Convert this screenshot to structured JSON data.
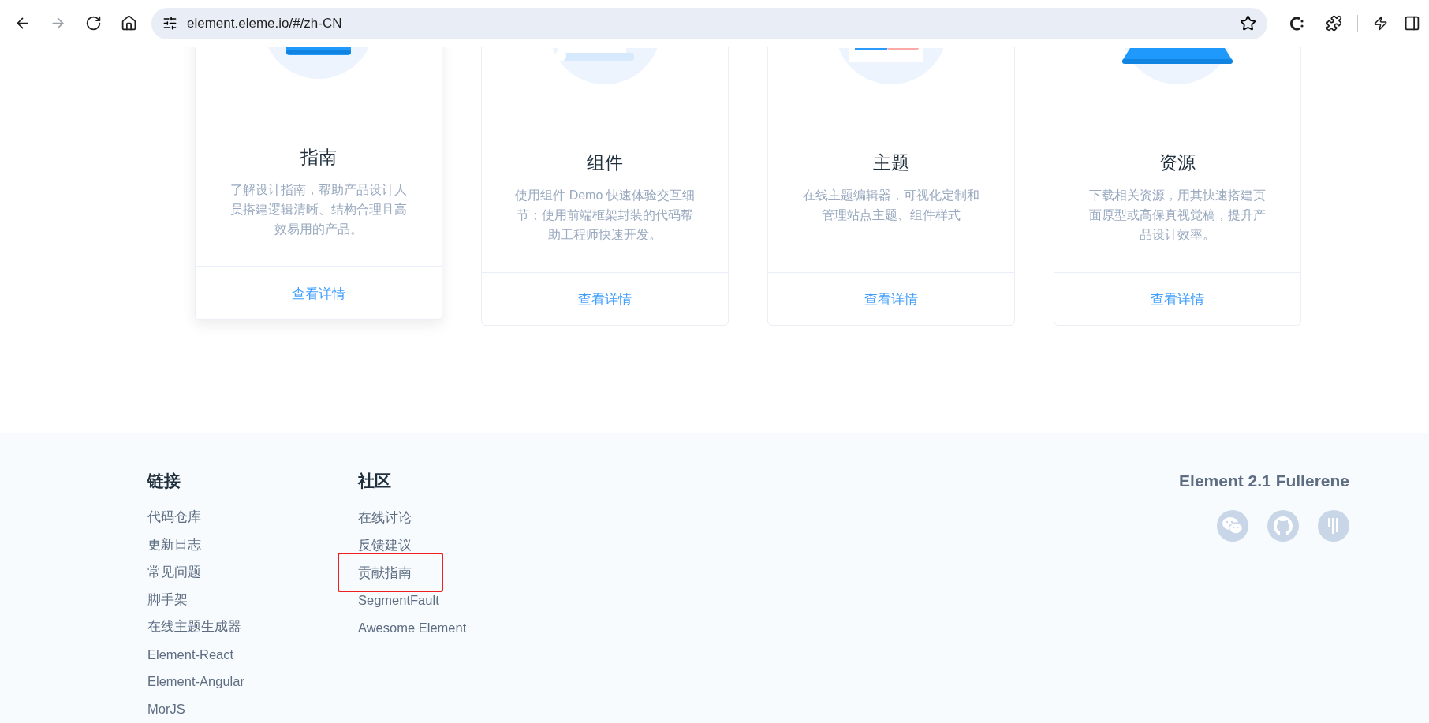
{
  "browser": {
    "nav": [
      {
        "kind": "back",
        "disabled": false
      },
      {
        "kind": "forward",
        "disabled": true
      },
      {
        "kind": "reload",
        "disabled": false
      },
      {
        "kind": "home",
        "disabled": false
      }
    ],
    "url": "element.eleme.io/#/zh-CN"
  },
  "cards": [
    {
      "kind": "guide",
      "title": "指南",
      "description": "了解设计指南，帮助产品设计人员搭建逻辑清晰、结构合理且高效易用的产品。",
      "link": "查看详情",
      "raised": true
    },
    {
      "kind": "component",
      "title": "组件",
      "description": "使用组件 Demo 快速体验交互细节；使用前端框架封装的代码帮助工程师快速开发。",
      "link": "查看详情",
      "raised": false
    },
    {
      "kind": "theme",
      "title": "主题",
      "description": "在线主题编辑器，可视化定制和管理站点主题、组件样式",
      "link": "查看详情",
      "raised": false
    },
    {
      "kind": "resource",
      "title": "资源",
      "description": "下载相关资源，用其快速搭建页面原型或高保真视觉稿，提升产品设计效率。",
      "link": "查看详情",
      "raised": false
    }
  ],
  "footer": {
    "columns": [
      {
        "heading": "链接",
        "links": [
          {
            "label": "代码仓库",
            "highlighted": false
          },
          {
            "label": "更新日志",
            "highlighted": false
          },
          {
            "label": "常见问题",
            "highlighted": false
          },
          {
            "label": "脚手架",
            "highlighted": false
          },
          {
            "label": "在线主题生成器",
            "highlighted": false
          },
          {
            "label": "Element-React",
            "highlighted": false
          },
          {
            "label": "Element-Angular",
            "highlighted": false
          },
          {
            "label": "MorJS",
            "highlighted": false
          }
        ]
      },
      {
        "heading": "社区",
        "links": [
          {
            "label": "在线讨论",
            "highlighted": false
          },
          {
            "label": "反馈建议",
            "highlighted": false
          },
          {
            "label": "贡献指南",
            "highlighted": true
          },
          {
            "label": "SegmentFault",
            "highlighted": false
          },
          {
            "label": "Awesome Element",
            "highlighted": false
          }
        ]
      }
    ],
    "version": "Element 2.1 Fullerene"
  }
}
